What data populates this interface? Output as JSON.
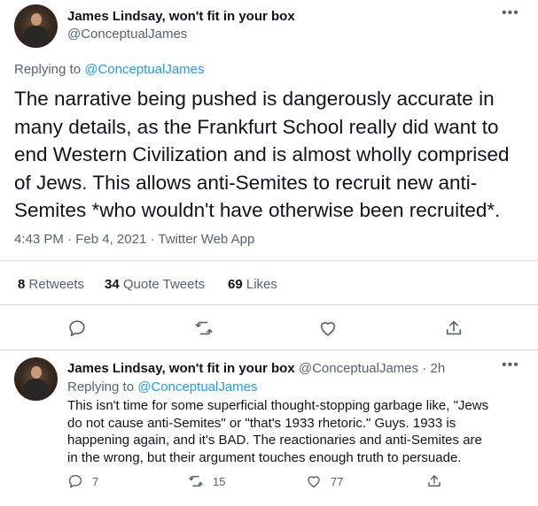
{
  "main_tweet": {
    "display_name": "James Lindsay, won't fit in your box",
    "handle": "@ConceptualJames",
    "replying_prefix": "Replying to",
    "replying_handle": "@ConceptualJames",
    "text": "The narrative being pushed is dangerously accurate in many details, as the Frankfurt School really did want to end Western Civilization and is almost wholly comprised of Jews. This allows anti-Semites to recruit new anti-Semites *who wouldn't have otherwise been recruited*.",
    "time": "4:43 PM",
    "date": "Feb 4, 2021",
    "client": "Twitter Web App",
    "separator": "·",
    "stats": {
      "retweets_count": "8",
      "retweets_label": "Retweets",
      "quotes_count": "34",
      "quotes_label": "Quote Tweets",
      "likes_count": "69",
      "likes_label": "Likes"
    },
    "more_icon": "more-horizontal-icon",
    "actions": [
      "reply-icon",
      "retweet-icon",
      "like-icon",
      "share-icon"
    ]
  },
  "reply_tweet": {
    "display_name": "James Lindsay, won't fit in your box",
    "handle": "@ConceptualJames",
    "separator": "·",
    "time_ago": "2h",
    "replying_prefix": "Replying to",
    "replying_handle": "@ConceptualJames",
    "text": "This isn't time for some superficial thought-stopping garbage like, \"Jews do not cause anti-Semites\" or \"that's 1933 rhetoric.\" Guys. 1933 is happening again, and it's BAD. The reactionaries and anti-Semites are in the wrong, but their argument touches enough truth to persuade.",
    "counts": {
      "replies": "7",
      "retweets": "15",
      "likes": "77"
    }
  },
  "colors": {
    "text": "#0f1419",
    "muted": "#536471",
    "link": "#1d9bf0",
    "divider": "#cfd9de"
  }
}
